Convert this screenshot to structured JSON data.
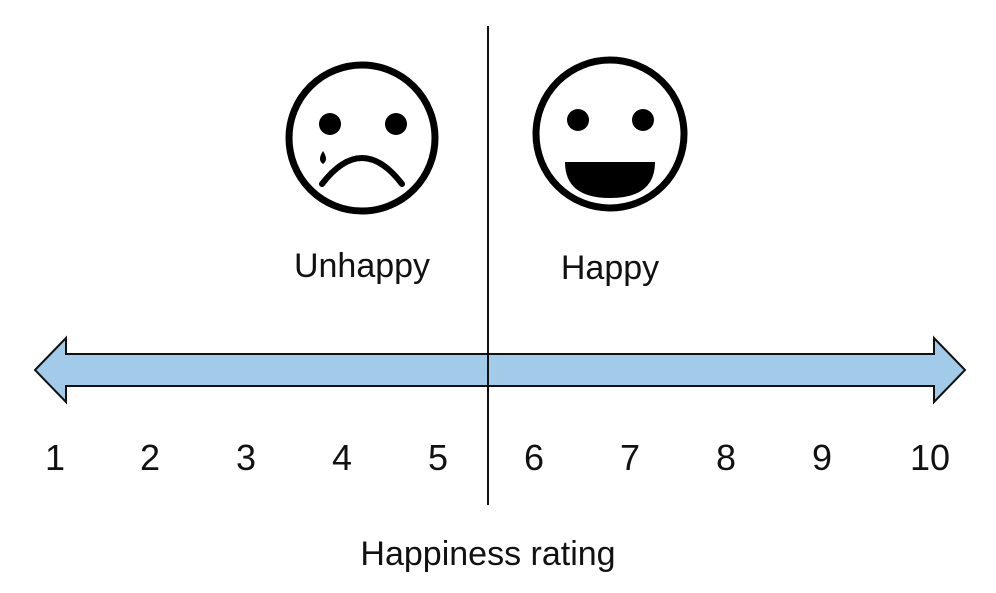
{
  "colors": {
    "arrow_fill": "#a2cbea",
    "arrow_stroke": "#111111",
    "divider": "#111111",
    "face_stroke": "#000000"
  },
  "icons": {
    "sad_face": "sad-face-icon",
    "happy_face": "happy-face-icon"
  },
  "labels": {
    "unhappy": "Unhappy",
    "happy": "Happy",
    "axis_title": "Happiness rating"
  },
  "scale": {
    "ticks": [
      "1",
      "2",
      "3",
      "4",
      "5",
      "6",
      "7",
      "8",
      "9",
      "10"
    ],
    "divider_between": [
      "5",
      "6"
    ]
  }
}
